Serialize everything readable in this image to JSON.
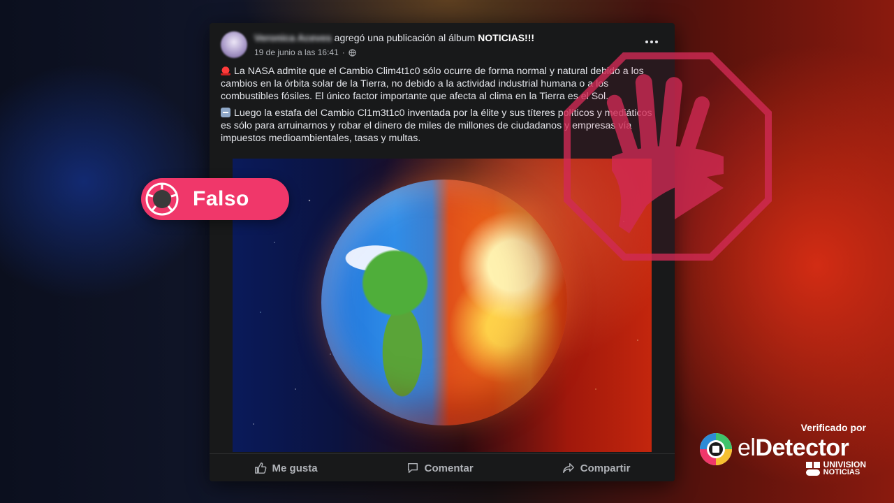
{
  "post": {
    "author": "Veronica Aceves",
    "action_text": "agregó una publicación al álbum",
    "album": "NOTICIAS!!!",
    "timestamp": "19 de junio a las 16:41",
    "privacy_icon": "globe-icon",
    "paragraph1": "La NASA admite que el Cambio Clim4t1c0 sólo ocurre de forma normal y natural debido a los cambios en la órbita solar de la Tierra, no debido a la actividad industrial humana o a los combustibles fósiles. El único factor importante que afecta al clima en la Tierra es el Sol.",
    "paragraph2": "Luego la estafa del Cambio Cl1m3t1c0 inventada por la élite y sus títeres políticos y mediáticos es sólo para arruinarnos y robar el dinero de miles de millones de ciudadanos y empresas vía impuestos medioambientales, tasas y multas.",
    "image_alt": "Earth half blue and green, half burning red"
  },
  "actions": {
    "like": "Me gusta",
    "comment": "Comentar",
    "share": "Compartir"
  },
  "badge": {
    "label": "Falso",
    "color": "#f0376a"
  },
  "branding": {
    "verified_by": "Verificado por",
    "el": "el",
    "detector": "Detector",
    "univision": "UNIVISION",
    "noticias": "NOTICIAS"
  },
  "colors": {
    "post_bg": "#18191a",
    "text": "#e4e6eb",
    "muted": "#b0b3b8",
    "stop_sign": "#d12a55"
  }
}
